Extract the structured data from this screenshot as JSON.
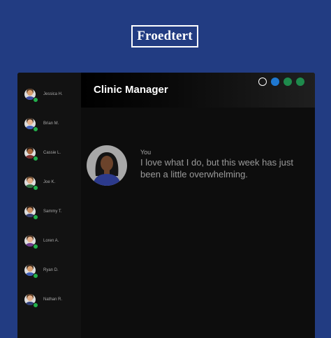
{
  "logo": {
    "text": "Froedtert"
  },
  "window": {
    "title": "Clinic Manager",
    "controls": [
      {
        "name": "window-control-outline",
        "color": "#ffffff",
        "style": "outline"
      },
      {
        "name": "window-control-blue",
        "color": "#1f78d1",
        "style": "filled"
      },
      {
        "name": "window-control-green-1",
        "color": "#1e8a4c",
        "style": "filled"
      },
      {
        "name": "window-control-green-2",
        "color": "#1e8a4c",
        "style": "filled"
      }
    ]
  },
  "contacts": [
    {
      "name": "Jessica H.",
      "skin": "#d9a070",
      "hair": "#5a3b22",
      "status": "online"
    },
    {
      "name": "Brian M.",
      "skin": "#e8b48e",
      "hair": "#3a2a1e",
      "status": "online"
    },
    {
      "name": "Cassie L.",
      "skin": "#a8683e",
      "hair": "#2b1c12",
      "status": "online"
    },
    {
      "name": "Joe K.",
      "skin": "#e2ae88",
      "hair": "#6b4a2e",
      "status": "online"
    },
    {
      "name": "Sammy T.",
      "skin": "#c88d62",
      "hair": "#2b1c12",
      "status": "online"
    },
    {
      "name": "Loren A.",
      "skin": "#e8b48e",
      "hair": "#4a3423",
      "status": "online"
    },
    {
      "name": "Ryan D.",
      "skin": "#d9a070",
      "hair": "#3a2a1e",
      "status": "online"
    },
    {
      "name": "Nathan R.",
      "skin": "#e2ae88",
      "hair": "#5a3b22",
      "status": "online"
    }
  ],
  "message": {
    "sender": "You",
    "text": "I love what I do, but this week has just been a little overwhelming.",
    "avatar": {
      "skin": "#6b432b",
      "hair": "#141414",
      "top": "#2c3a8c"
    }
  },
  "colors": {
    "page_background": "#223c82",
    "status_online": "#22b14c",
    "torso_colors": [
      "#3a4aa0",
      "#3b5bb5",
      "#7a2a2a",
      "#2f6b3f",
      "#333c6e",
      "#6b3a8c",
      "#3b5bb5",
      "#2f3f7a"
    ]
  }
}
